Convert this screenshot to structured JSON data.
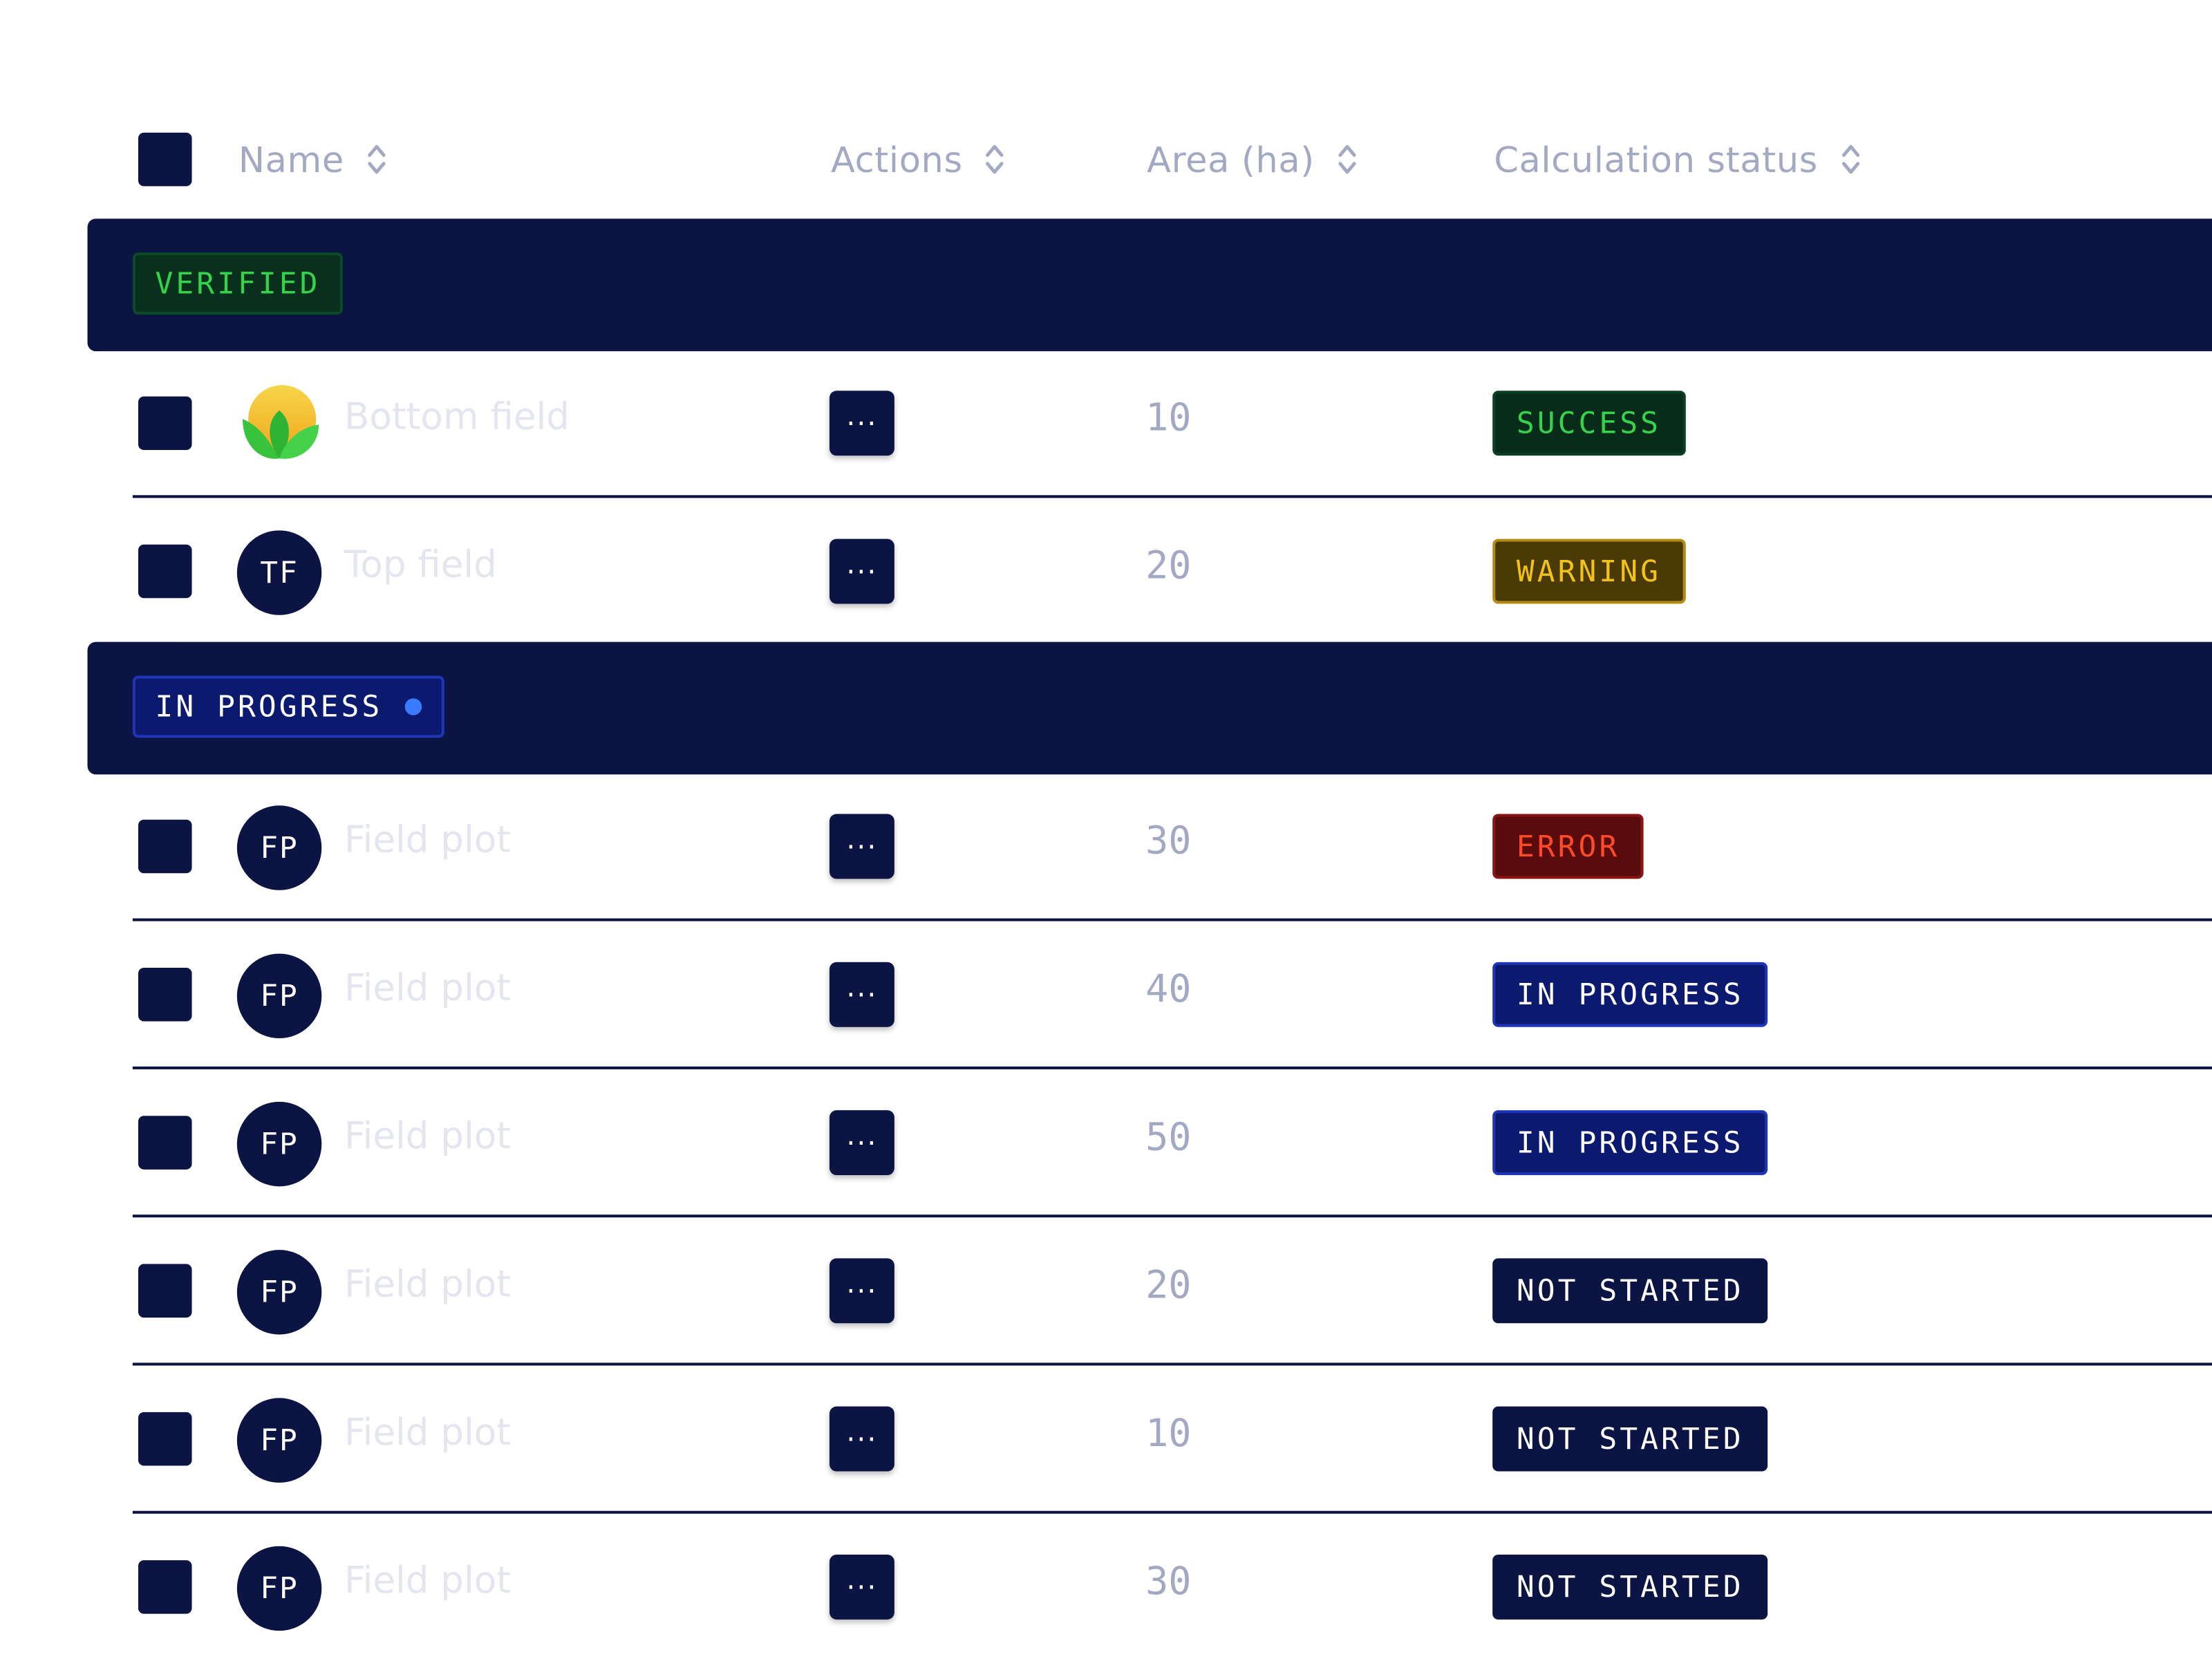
{
  "table": {
    "columns": [
      {
        "label": "Name"
      },
      {
        "label": "Actions"
      },
      {
        "label": "Area (ha)"
      },
      {
        "label": "Calculation status"
      }
    ],
    "groups": [
      {
        "label": "VERIFIED",
        "rows": [
          {
            "avatar": "",
            "avatar_icon": "leaf-logo-icon",
            "name": "Bottom field",
            "actions": "···",
            "area": "10",
            "status": "SUCCESS"
          },
          {
            "avatar": "TF",
            "name": "Top field",
            "actions": "···",
            "area": "20",
            "status": "WARNING"
          }
        ]
      },
      {
        "label": "IN PROGRESS",
        "rows": [
          {
            "avatar": "FP",
            "name": "Field plot",
            "actions": "···",
            "area": "30",
            "status": "ERROR"
          },
          {
            "avatar": "FP",
            "name": "Field plot",
            "actions": "···",
            "area": "40",
            "status": "IN PROGRESS"
          },
          {
            "avatar": "FP",
            "name": "Field plot",
            "actions": "···",
            "area": "50",
            "status": "IN PROGRESS"
          },
          {
            "avatar": "FP",
            "name": "Field plot",
            "actions": "···",
            "area": "20",
            "status": "NOT STARTED"
          },
          {
            "avatar": "FP",
            "name": "Field plot",
            "actions": "···",
            "area": "10",
            "status": "NOT STARTED"
          },
          {
            "avatar": "FP",
            "name": "Field plot",
            "actions": "···",
            "area": "30",
            "status": "NOT STARTED"
          }
        ]
      }
    ]
  },
  "colors": {
    "navy": "#0b1443",
    "success": "#36d34c",
    "warning": "#f2c21a",
    "error": "#ff4a2a",
    "progress_dot": "#3b7bff",
    "muted_text": "#a4a9c3"
  }
}
